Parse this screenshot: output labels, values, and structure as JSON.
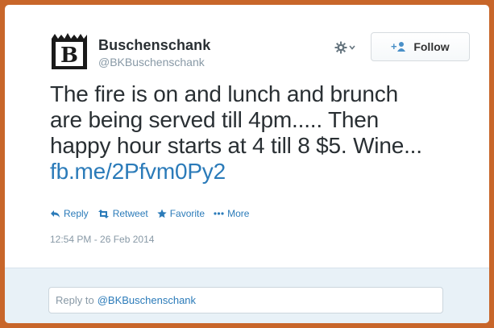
{
  "colors": {
    "frame": "#c8662a",
    "link": "#2b7bb9",
    "muted": "#8899a6",
    "text": "#292f33",
    "reply_bg": "#e8f1f7"
  },
  "user": {
    "display_name": "Buschenschank",
    "handle": "@BKBuschenschank",
    "avatar_icon": "buschenschank-logo-icon"
  },
  "controls": {
    "gear_icon": "gear-icon",
    "follow_label": "Follow",
    "follow_icon": "follow-user-icon"
  },
  "tweet": {
    "lines": [
      "The fire is on and lunch and brunch",
      "are being served till 4pm..... Then",
      "happy hour starts at 4 till 8 $5. Wine..."
    ],
    "link": "fb.me/2Pfvm0Py2",
    "timestamp": "12:54 PM - 26 Feb 2014"
  },
  "actions": [
    {
      "label": "Reply",
      "icon": "reply-icon"
    },
    {
      "label": "Retweet",
      "icon": "retweet-icon"
    },
    {
      "label": "Favorite",
      "icon": "star-icon"
    },
    {
      "label": "More",
      "icon": "more-dots-icon"
    }
  ],
  "reply": {
    "prefix": "Reply to",
    "mention": "@BKBuschenschank"
  }
}
